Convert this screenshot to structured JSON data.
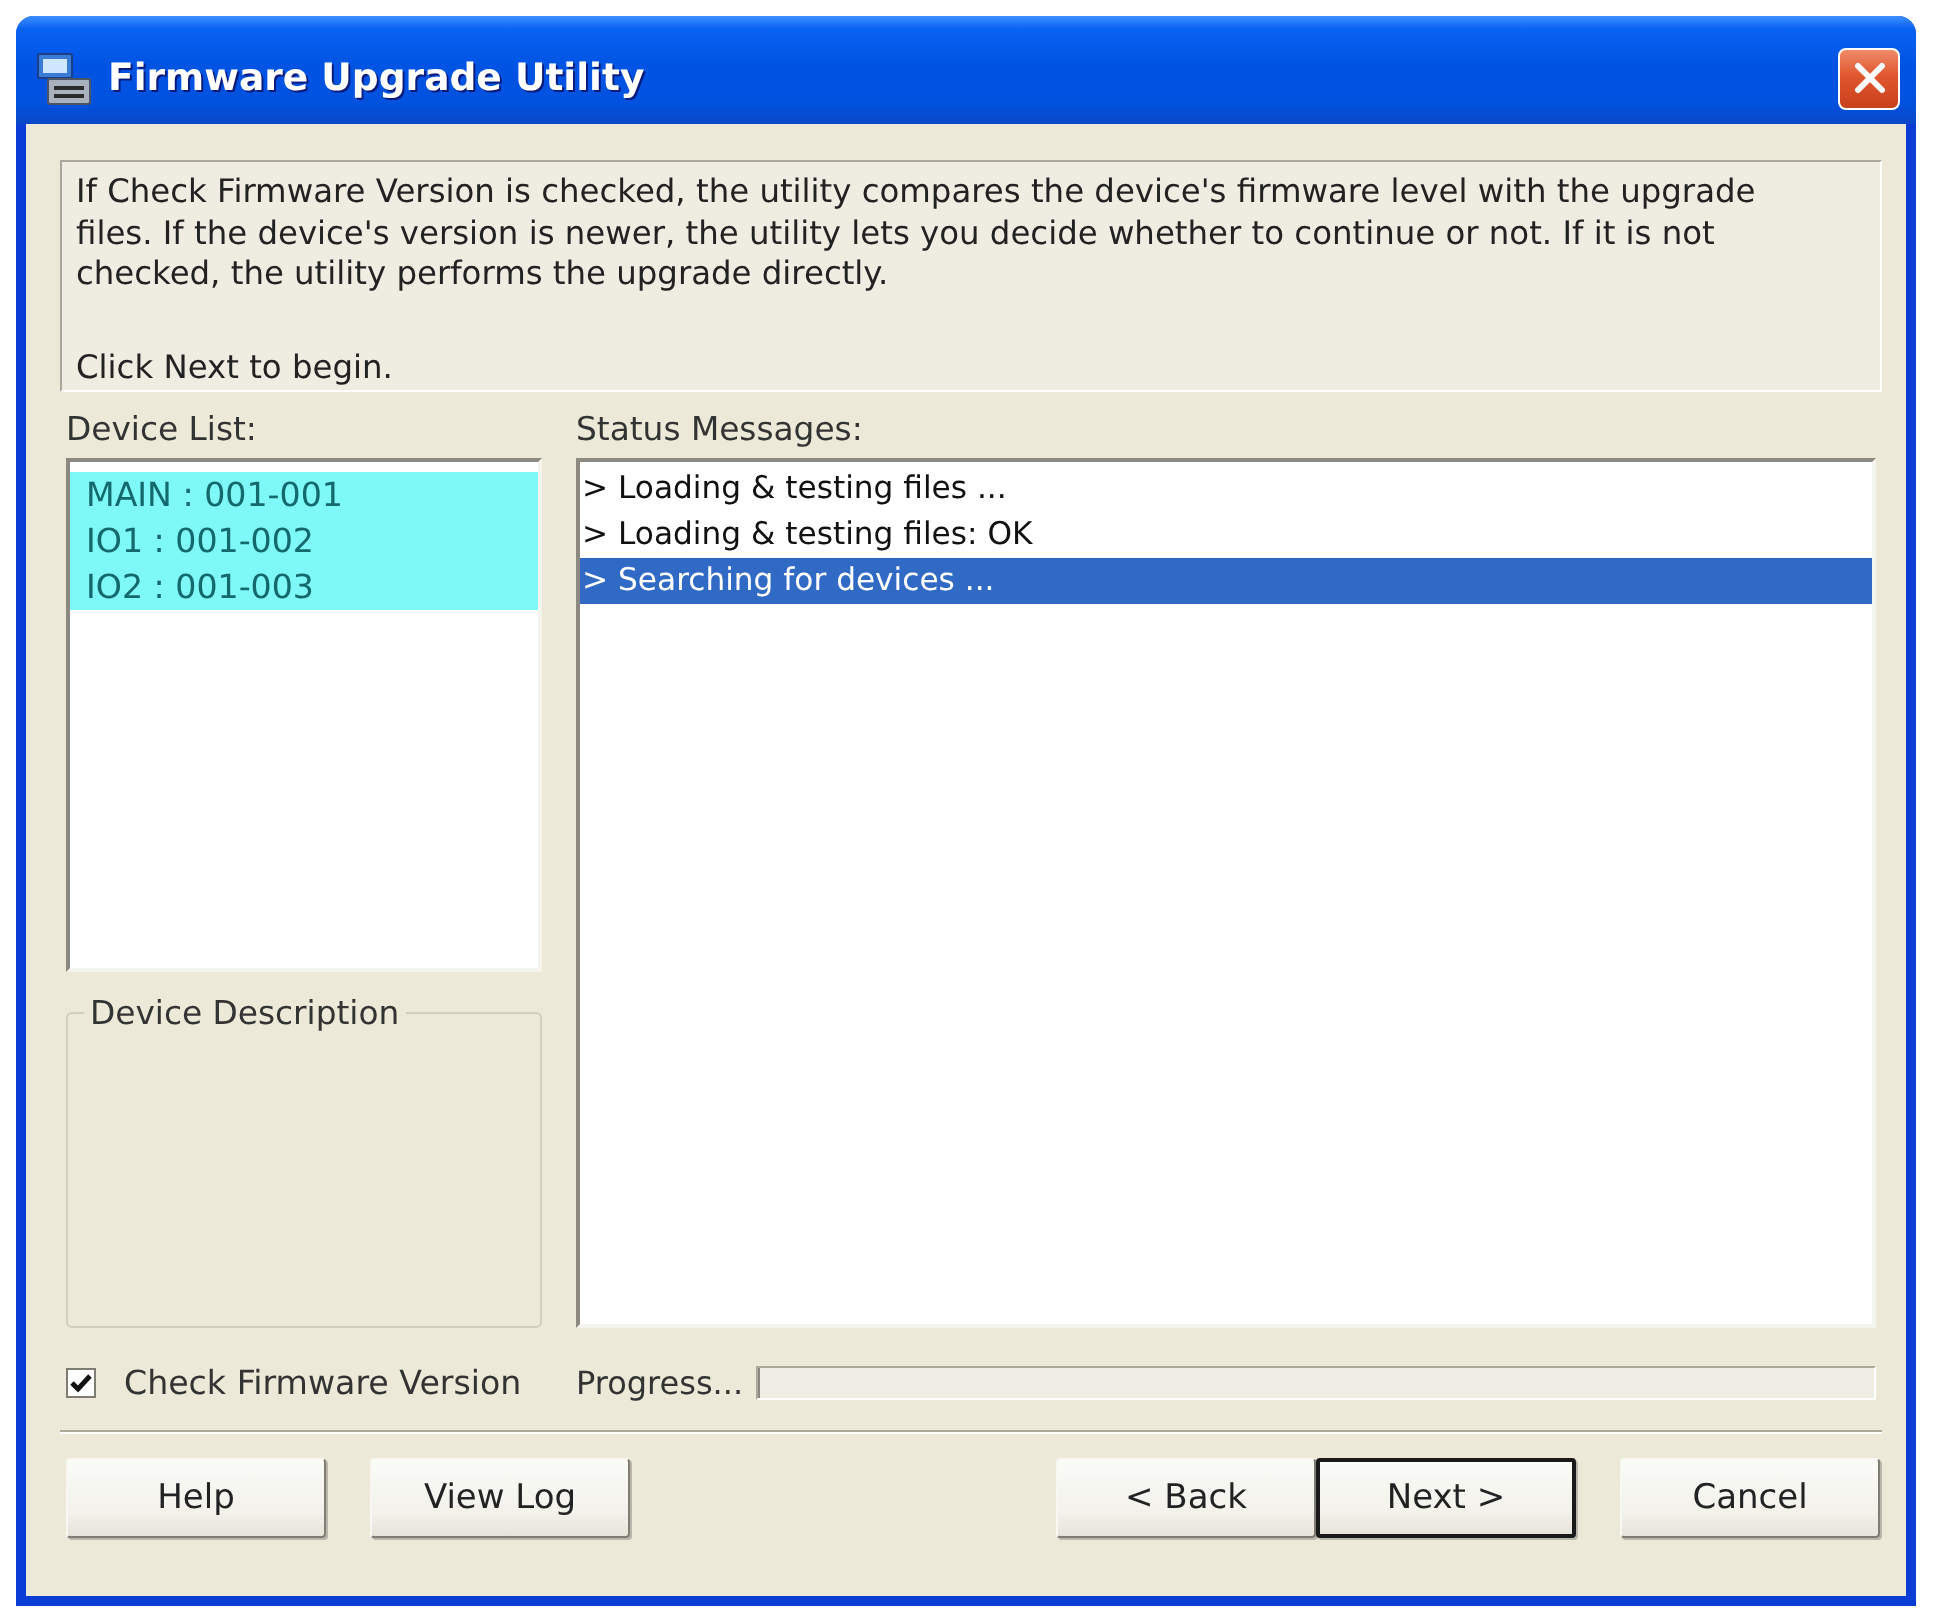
{
  "window": {
    "title": "Firmware Upgrade Utility"
  },
  "instructions": {
    "text": "If Check Firmware Version is checked, the utility compares the device's firmware level with the upgrade files. If the device's version is newer, the utility lets you decide whether to continue or not. If it is not checked, the utility performs the upgrade directly.",
    "hint": "Click Next to begin."
  },
  "device_list": {
    "label": "Device List:",
    "items": [
      {
        "text": "MAIN : 001-001",
        "selected": true
      },
      {
        "text": "IO1 : 001-002",
        "selected": true
      },
      {
        "text": "IO2 : 001-003",
        "selected": true
      }
    ]
  },
  "device_description": {
    "label": "Device Description"
  },
  "status_messages": {
    "label": "Status Messages:",
    "items": [
      {
        "text": "> Loading & testing files ...",
        "selected": false
      },
      {
        "text": "> Loading & testing files: OK",
        "selected": false
      },
      {
        "text": "> Searching for devices ...",
        "selected": true
      }
    ]
  },
  "check_firmware_version": {
    "label": "Check Firmware Version",
    "checked": true
  },
  "progress": {
    "label": "Progress...",
    "level": 0
  },
  "buttons": {
    "left": [
      {
        "label": "Help",
        "focused": false
      },
      {
        "label": "View Log",
        "focused": false
      }
    ],
    "right": [
      {
        "label": "< Back",
        "focused": false
      },
      {
        "label": "Next >",
        "focused": true
      },
      {
        "label": "Cancel",
        "focused": false
      }
    ]
  }
}
